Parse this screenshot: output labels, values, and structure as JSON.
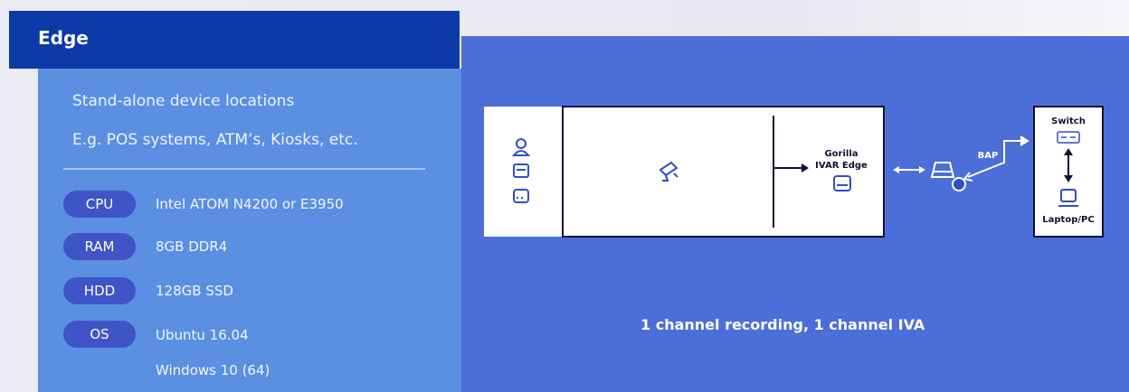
{
  "header": {
    "title": "Edge"
  },
  "description": {
    "line1": "Stand-alone device locations",
    "line2": "E.g. POS systems, ATM’s, Kiosks, etc."
  },
  "specs": [
    {
      "label": "CPU",
      "value": "Intel ATOM N4200 or E3950"
    },
    {
      "label": "RAM",
      "value": "8GB DDR4"
    },
    {
      "label": "HDD",
      "value": "128GB SSD"
    },
    {
      "label": "OS",
      "value": "Ubuntu 16.04"
    }
  ],
  "specs_extra": {
    "os_value2": "Windows 10 (64)"
  },
  "diagram": {
    "device_line1": "Gorilla",
    "device_line2": "IVAR Edge",
    "bap_label": "BAP",
    "switch_label": "Switch",
    "laptop_label": "Laptop/PC",
    "caption": "1 channel recording, 1 channel IVA"
  },
  "colors": {
    "header": "#0c3aa8",
    "left_panel": "#5b8fe2",
    "main_panel": "#4c6ed9",
    "badge": "#3f54c6",
    "icon": "#2f4fc4"
  },
  "icons": [
    "person-icon",
    "pos-terminal-icon",
    "server-icon",
    "camera-icon",
    "edge-device-icon",
    "network-device-icon",
    "switch-icon",
    "laptop-icon"
  ]
}
